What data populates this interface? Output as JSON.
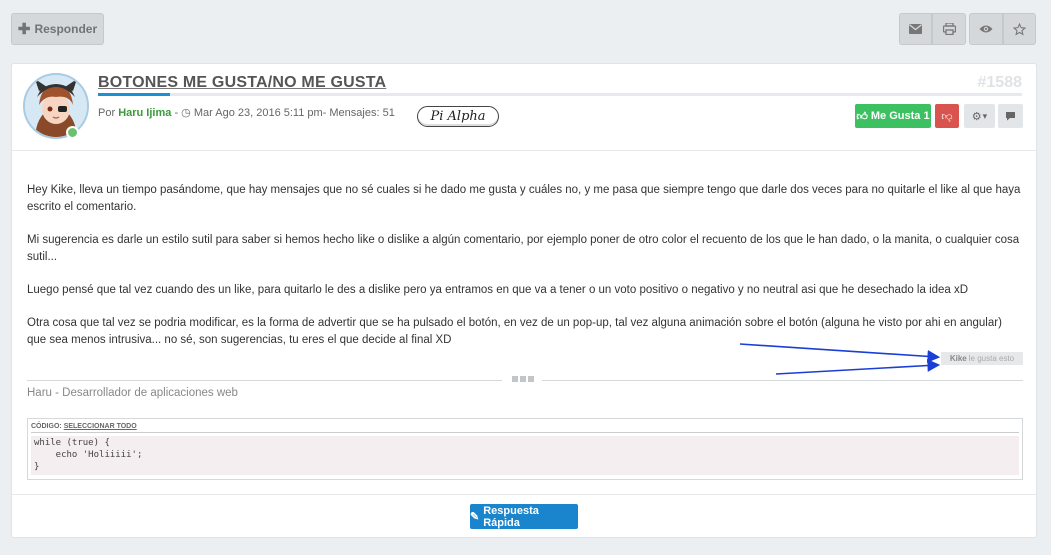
{
  "toolbar": {
    "reply_label": "Responder",
    "icons": [
      "envelope-icon",
      "print-icon",
      "eye-icon",
      "star-icon"
    ]
  },
  "post": {
    "title": "BOTONES ME GUSTA/NO ME GUSTA",
    "number": "#1588",
    "meta_prefix": "Por",
    "author": "Haru Ijima",
    "meta_sep": "-",
    "date": "Mar Ago 23, 2016 5:11 pm",
    "messages_label": "- Mensajes:",
    "messages_count": "51",
    "rank_badge": "Pi Alpha",
    "like_label": "Me Gusta",
    "like_count": "1",
    "paragraphs": [
      "Hey Kike, lleva un tiempo pasándome, que hay mensajes que no sé cuales si he dado me gusta y cuáles no, y me pasa que siempre tengo que darle dos veces para no quitarle el like al que haya escrito el comentario.",
      "Mi sugerencia es darle un estilo sutil para saber si hemos hecho like o dislike a algún comentario, por ejemplo poner de otro color el recuento de los que le han dado, o la manita, o cualquier cosa sutil...",
      "Luego pensé que tal vez cuando des un like, para quitarlo le des a dislike pero ya entramos en que va a tener o un voto positivo o negativo y no neutral asi que he desechado la idea xD",
      "Otra cosa que tal vez se podria modificar, es la forma de advertir que se ha pulsado el botón, en vez de un pop-up, tal vez alguna animación sobre el botón (alguna he visto por ahi en angular) que sea menos intrusiva... no sé, son sugerencias, tu eres el que decide al final XD"
    ],
    "likes_user": "Kike",
    "likes_text": "le gusta esto",
    "signature": "Haru - Desarrollador de aplicaciones web",
    "code_label": "CÓDIGO:",
    "code_select": "SELECCIONAR TODO",
    "code": "while (true) {\n    echo 'Holiiiii';\n}",
    "quick_reply": "Respuesta Rápida"
  },
  "colors": {
    "accent": "#1a91d2",
    "like": "#3cc062",
    "dislike": "#d9534f",
    "user": "#3a9b3a",
    "annotation_arrow": "#1a3fd6"
  }
}
